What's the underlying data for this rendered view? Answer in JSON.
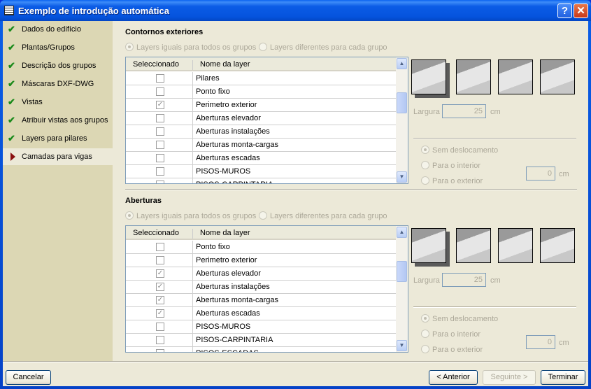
{
  "window": {
    "title": "Exemplo de introdução automática",
    "help": "?",
    "close": "✕"
  },
  "sidebar": {
    "items": [
      {
        "label": "Dados do edifício",
        "done": true
      },
      {
        "label": "Plantas/Grupos",
        "done": true
      },
      {
        "label": "Descrição dos grupos",
        "done": true
      },
      {
        "label": "Máscaras DXF-DWG",
        "done": true
      },
      {
        "label": "Vistas",
        "done": true
      },
      {
        "label": "Atribuir vistas aos grupos",
        "done": true
      },
      {
        "label": "Layers para pilares",
        "done": true
      },
      {
        "label": "Camadas para vigas",
        "done": false,
        "active": true
      }
    ]
  },
  "contornos": {
    "title": "Contornos exteriores",
    "radio_same": "Layers iguais para todos os grupos",
    "radio_diff": "Layers diferentes para cada grupo",
    "col_sel": "Seleccionado",
    "col_name": "Nome da layer",
    "rows": [
      {
        "name": "Pilares",
        "checked": false
      },
      {
        "name": "Ponto fixo",
        "checked": false
      },
      {
        "name": "Perimetro exterior",
        "checked": true
      },
      {
        "name": "Aberturas elevador",
        "checked": false
      },
      {
        "name": "Aberturas instalações",
        "checked": false
      },
      {
        "name": "Aberturas monta-cargas",
        "checked": false
      },
      {
        "name": "Aberturas escadas",
        "checked": false
      },
      {
        "name": "PISOS-MUROS",
        "checked": false
      },
      {
        "name": "PISOS-CARPINTARIA",
        "checked": false
      }
    ],
    "largura_label": "Largura",
    "largura_value": "25",
    "unit": "cm",
    "offset_none": "Sem deslocamento",
    "offset_in": "Para o interior",
    "offset_out": "Para o exterior",
    "offset_value": "0"
  },
  "aberturas": {
    "title": "Aberturas",
    "radio_same": "Layers iguais para todos os grupos",
    "radio_diff": "Layers diferentes para cada grupo",
    "col_sel": "Seleccionado",
    "col_name": "Nome da layer",
    "rows": [
      {
        "name": "Ponto fixo",
        "checked": false
      },
      {
        "name": "Perimetro exterior",
        "checked": false
      },
      {
        "name": "Aberturas elevador",
        "checked": true
      },
      {
        "name": "Aberturas instalações",
        "checked": true
      },
      {
        "name": "Aberturas monta-cargas",
        "checked": true
      },
      {
        "name": "Aberturas escadas",
        "checked": true
      },
      {
        "name": "PISOS-MUROS",
        "checked": false
      },
      {
        "name": "PISOS-CARPINTARIA",
        "checked": false
      },
      {
        "name": "PISOS-ESCADAS",
        "checked": false
      }
    ],
    "largura_label": "Largura",
    "largura_value": "25",
    "unit": "cm",
    "offset_none": "Sem deslocamento",
    "offset_in": "Para o interior",
    "offset_out": "Para o exterior",
    "offset_value": "0"
  },
  "buttons": {
    "cancel": "Cancelar",
    "back": "< Anterior",
    "next": "Seguinte >",
    "finish": "Terminar"
  }
}
